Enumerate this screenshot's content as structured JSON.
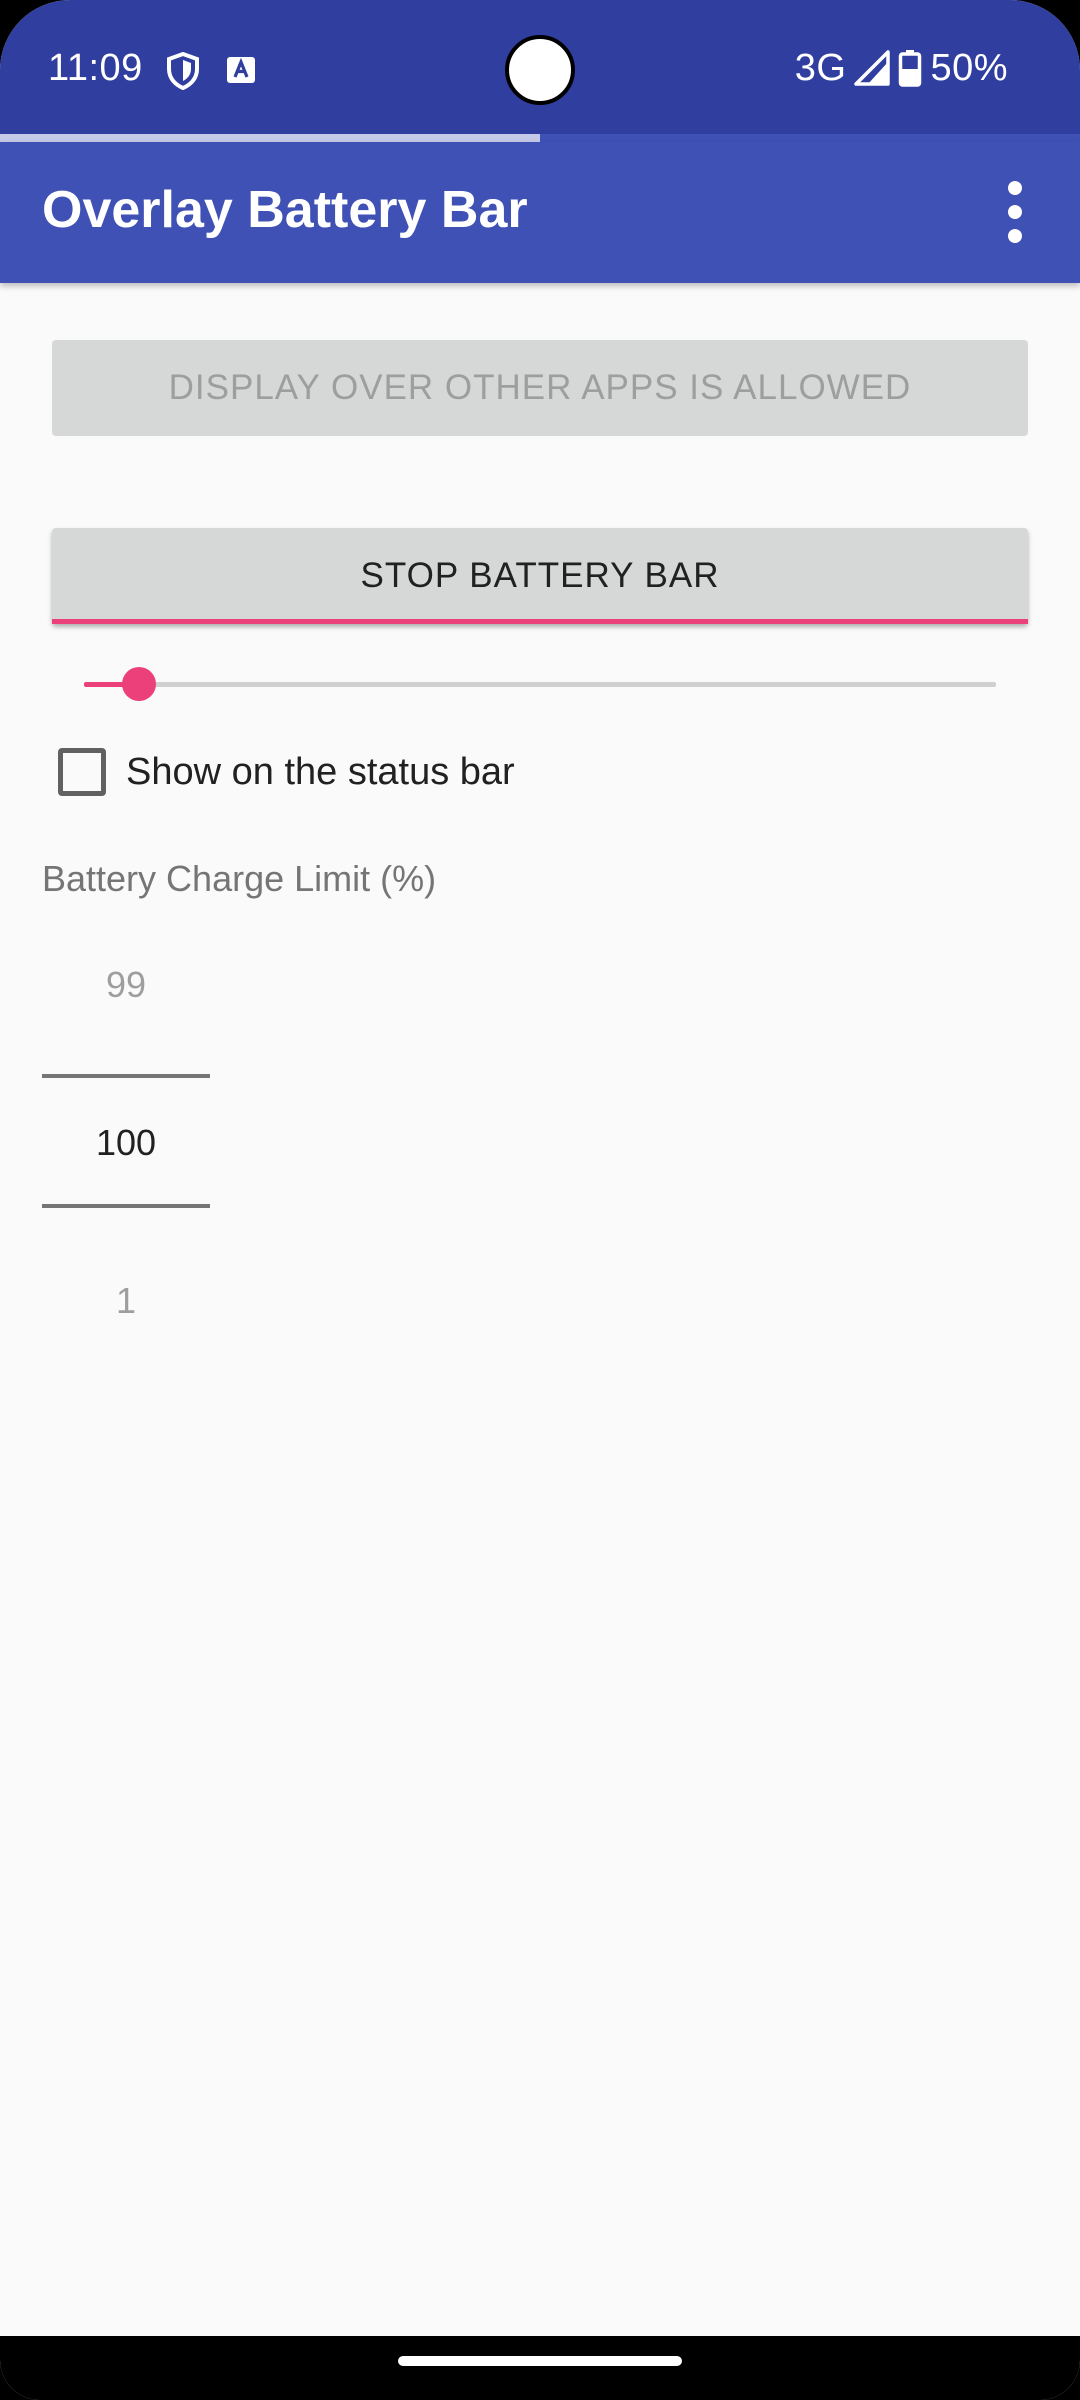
{
  "status_bar": {
    "time": "11:09",
    "network": "3G",
    "battery_percent": "50%",
    "background_color": "#303f9f",
    "icons": [
      "shield-icon",
      "a-notification-icon",
      "signal-icon",
      "battery-icon"
    ]
  },
  "progress": {
    "value_fraction": 0.5
  },
  "app_bar": {
    "title": "Overlay Battery Bar",
    "background_color": "#3f51b5",
    "menu_icon": "more-vert-icon"
  },
  "main": {
    "overlay_permission_button": "DISPLAY OVER OTHER APPS IS ALLOWED",
    "stop_button": "STOP BATTERY BAR",
    "slider": {
      "value_fraction": 0.06,
      "accent_color": "#ec407a"
    },
    "status_bar_checkbox": {
      "label": "Show on the status bar",
      "checked": false
    },
    "charge_limit": {
      "label": "Battery Charge Limit (%)",
      "previous": "99",
      "current": "100",
      "next": "1"
    }
  }
}
